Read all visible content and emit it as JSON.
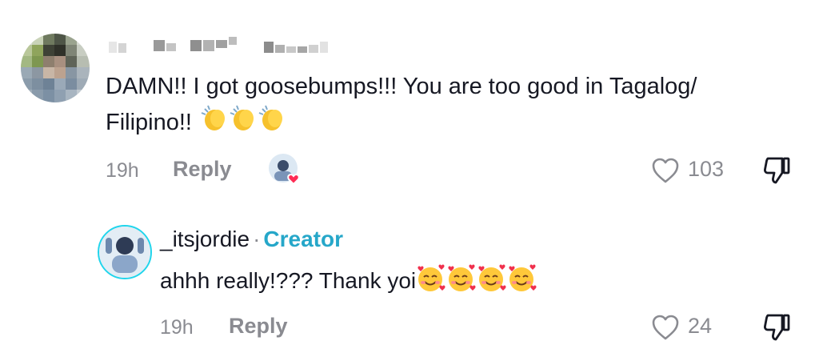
{
  "comment": {
    "author_redacted": true,
    "text": "DAMN!! I got goosebumps!!! You are too good in Tagalog/ Filipino!!",
    "emoji": "clapping-hands x3",
    "time": "19h",
    "reply_label": "Reply",
    "likes": "103"
  },
  "reply": {
    "username": "_itsjordie",
    "separator": "·",
    "badge": "Creator",
    "text": "ahhh really!??? Thank yoi",
    "emoji": "smiling-face-with-hearts x4",
    "time": "19h",
    "reply_label": "Reply",
    "likes": "24"
  },
  "colors": {
    "text": "#161823",
    "muted": "#8a8b91",
    "creator": "#26a7c9",
    "avatar_ring": "#20d5ec",
    "heart_badge": "#fe2c55"
  }
}
